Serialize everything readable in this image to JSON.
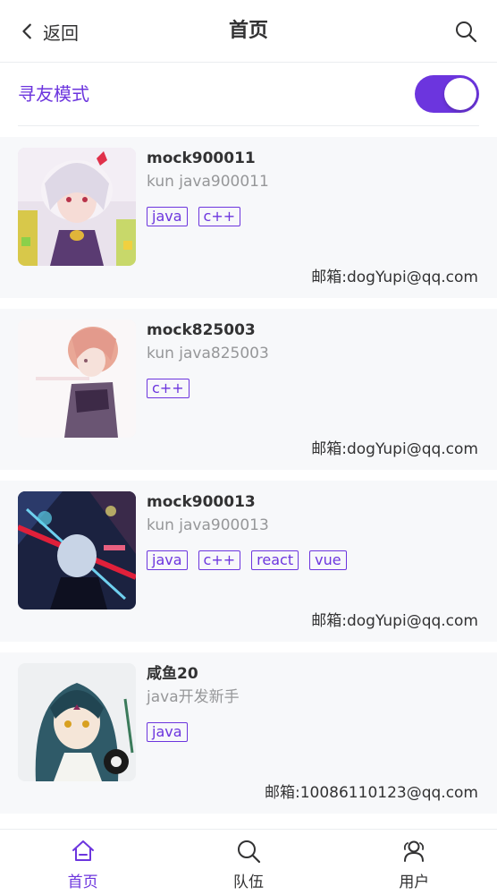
{
  "navbar": {
    "back_label": "返回",
    "title": "首页",
    "back_icon": "chevron-left-icon",
    "search_icon": "search-icon"
  },
  "friend_mode": {
    "label": "寻友模式",
    "enabled": true
  },
  "colors": {
    "accent": "#6c35de",
    "card_bg": "#f7f8fa",
    "muted_text": "#969799",
    "text": "#323233"
  },
  "users": [
    {
      "name": "mock900011",
      "profile": "kun java900011",
      "tags": [
        "java",
        "c++"
      ],
      "email": "邮箱:dogYupi@qq.com"
    },
    {
      "name": "mock825003",
      "profile": "kun java825003",
      "tags": [
        "c++"
      ],
      "email": "邮箱:dogYupi@qq.com"
    },
    {
      "name": "mock900013",
      "profile": "kun java900013",
      "tags": [
        "java",
        "c++",
        "react",
        "vue"
      ],
      "email": "邮箱:dogYupi@qq.com"
    },
    {
      "name": "咸鱼20",
      "profile": "java开发新手",
      "tags": [
        "java"
      ],
      "email": "邮箱:10086110123@qq.com"
    }
  ],
  "tabbar": {
    "items": [
      {
        "label": "首页",
        "icon": "home-icon",
        "active": true
      },
      {
        "label": "队伍",
        "icon": "search-icon",
        "active": false
      },
      {
        "label": "用户",
        "icon": "user-group-icon",
        "active": false
      }
    ]
  }
}
